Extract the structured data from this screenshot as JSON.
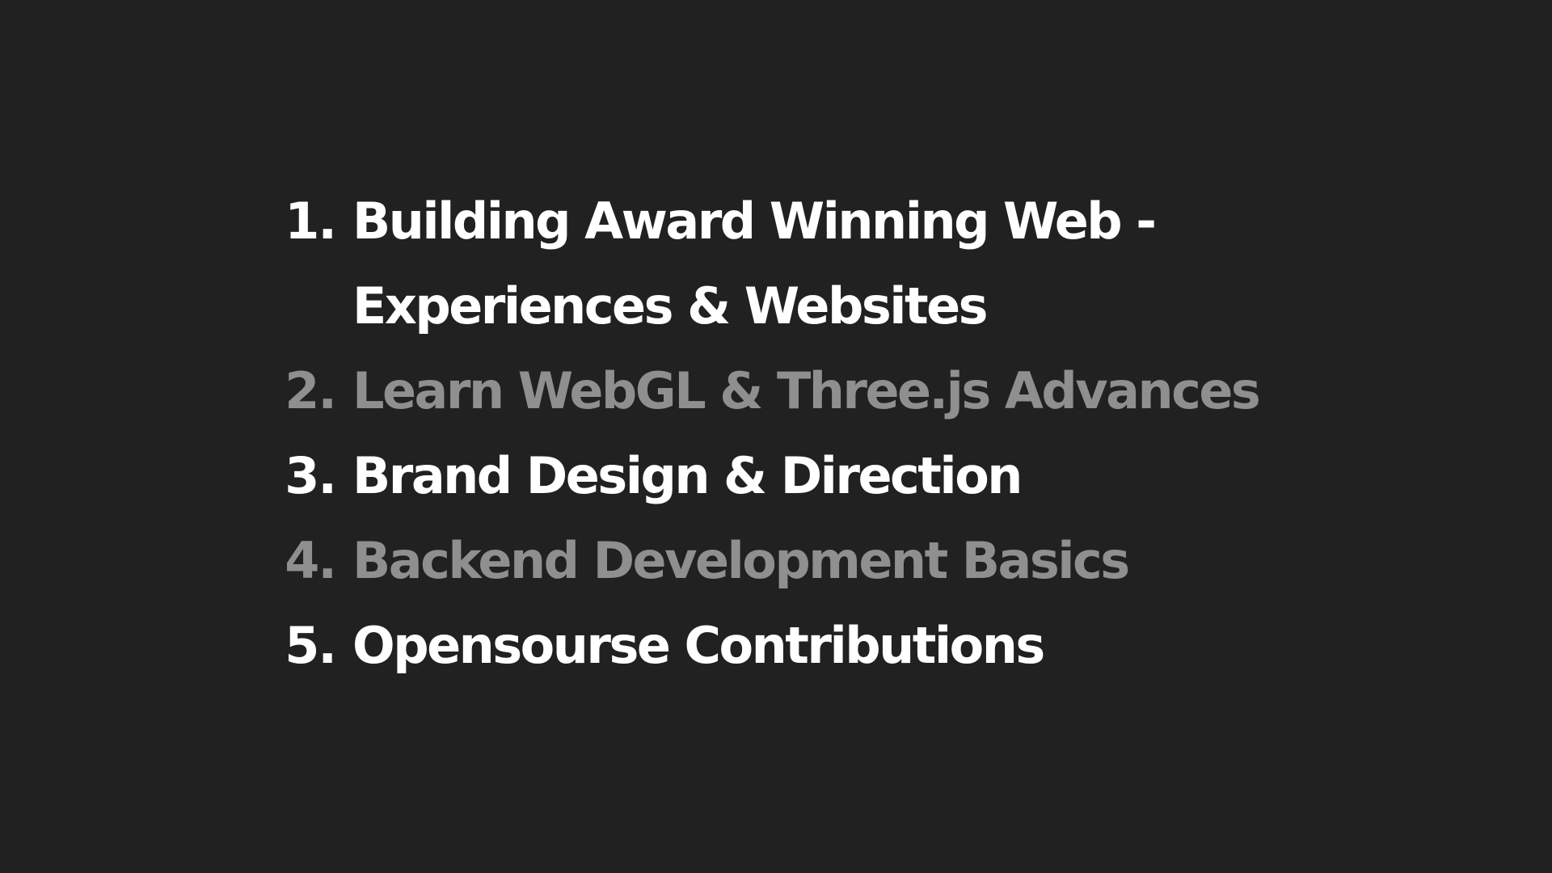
{
  "items": [
    {
      "number": "1.",
      "lines": [
        "Building Award Winning Web -",
        "Experiences & Websites"
      ],
      "color": "#ffffff"
    },
    {
      "number": "2.",
      "lines": [
        "Learn WebGL & Three.js Advances"
      ],
      "color": "#8f8f8f"
    },
    {
      "number": "3.",
      "lines": [
        "Brand Design & Direction"
      ],
      "color": "#ffffff"
    },
    {
      "number": "4.",
      "lines": [
        "Backend Development Basics"
      ],
      "color": "#8f8f8f"
    },
    {
      "number": "5.",
      "lines": [
        "Opensourse Contributions"
      ],
      "color": "#ffffff"
    }
  ],
  "colors": {
    "background": "#212121",
    "primary": "#ffffff",
    "muted": "#8f8f8f"
  }
}
